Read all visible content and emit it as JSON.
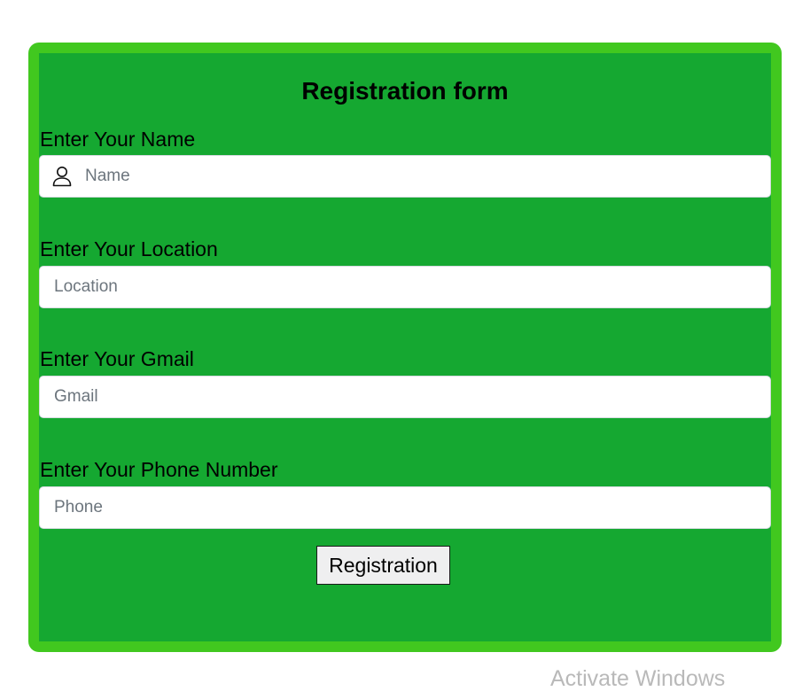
{
  "form": {
    "title": "Registration form",
    "name": {
      "label": "Enter Your Name",
      "placeholder": "Name",
      "value": "",
      "icon": "person-icon"
    },
    "location": {
      "label": "Enter Your Location",
      "placeholder": "Location",
      "value": ""
    },
    "gmail": {
      "label": "Enter Your Gmail",
      "placeholder": "Gmail",
      "value": ""
    },
    "phone": {
      "label": "Enter Your Phone Number",
      "placeholder": "Phone",
      "value": ""
    },
    "submit_label": "Registration"
  },
  "watermark": {
    "text": "Activate Windows"
  },
  "colors": {
    "outer_border": "#41c81f",
    "form_background": "#15a831",
    "input_background": "#ffffff",
    "button_background": "#efeff0"
  }
}
